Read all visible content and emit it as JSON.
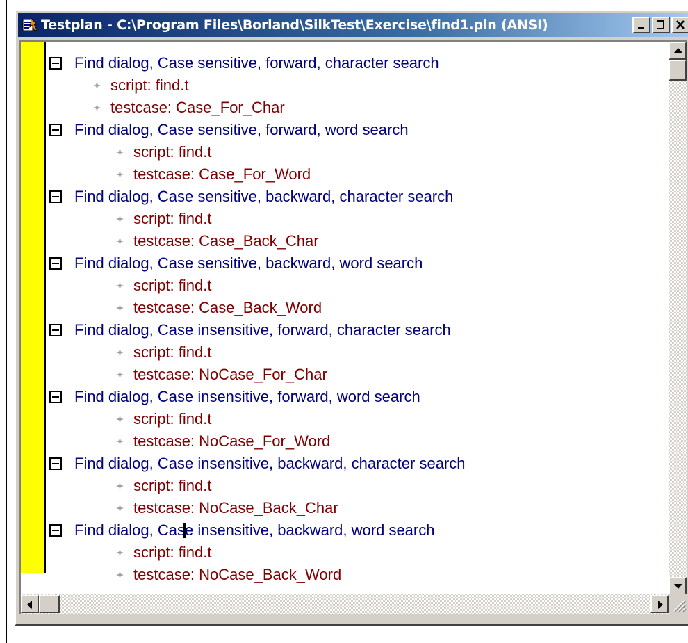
{
  "window": {
    "title": "Testplan - C:\\Program Files\\Borland\\SilkTest\\Exercise\\find1.pln (ANSI)",
    "icon": "testplan-app-icon",
    "buttons": [
      "minimize-icon",
      "restore-icon",
      "close-icon"
    ]
  },
  "colors": {
    "titlebar_start": "#0a246a",
    "group_text": "#000080",
    "leaf_text": "#800000",
    "margin_bar": "#ffff00"
  },
  "testplan": {
    "groups": [
      {
        "label": "Find dialog, Case sensitive, forward, character search",
        "script": "script: find.t",
        "testcase": "testcase: Case_For_Char"
      },
      {
        "label": "Find dialog, Case sensitive, forward, word search",
        "script": "script: find.t",
        "testcase": "testcase: Case_For_Word"
      },
      {
        "label": "Find dialog, Case sensitive, backward, character search",
        "script": "script: find.t",
        "testcase": "testcase: Case_Back_Char"
      },
      {
        "label": "Find dialog, Case sensitive, backward, word search",
        "script": "script: find.t",
        "testcase": "testcase: Case_Back_Word"
      },
      {
        "label": "Find dialog, Case insensitive, forward, character search",
        "script": "script: find.t",
        "testcase": "testcase: NoCase_For_Char"
      },
      {
        "label": "Find dialog, Case insensitive, forward, word search",
        "script": "script: find.t",
        "testcase": "testcase: NoCase_For_Word"
      },
      {
        "label": "Find dialog, Case insensitive, backward, character search",
        "script": "script: find.t",
        "testcase": "testcase: NoCase_Back_Char"
      },
      {
        "label": "Find dialog, Case insensitive, backward, word search",
        "script": "script: find.t",
        "testcase": "testcase: NoCase_Back_Word"
      }
    ]
  }
}
